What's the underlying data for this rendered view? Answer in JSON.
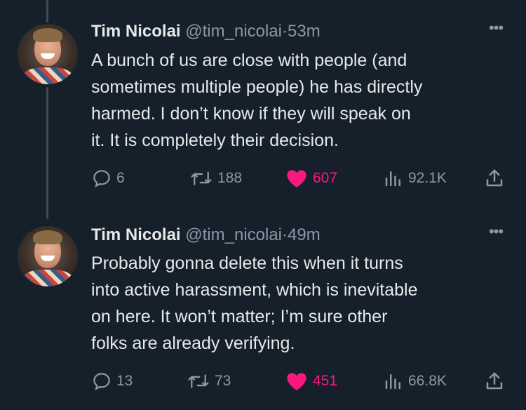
{
  "tweets": [
    {
      "name": "Tim Nicolai",
      "handle": "@tim_nicolai",
      "separator": "·",
      "time": "53m",
      "more": "•••",
      "lines": [
        "A bunch of us are close with people (and",
        "sometimes multiple people) he has directly",
        "harmed. I don’t know if they will speak on",
        "it. It is completely their decision."
      ],
      "replies": "6",
      "retweets": "188",
      "likes": "607",
      "views": "92.1K"
    },
    {
      "name": "Tim Nicolai",
      "handle": "@tim_nicolai",
      "separator": "·",
      "time": "49m",
      "more": "•••",
      "lines": [
        "Probably gonna delete this when it turns",
        "into active harassment, which is inevitable",
        "on here. It won’t matter; I’m sure other",
        "folks are already verifying."
      ],
      "replies": "13",
      "retweets": "73",
      "likes": "451",
      "views": "66.8K"
    }
  ],
  "colors": {
    "background": "#15202b",
    "text": "#e7e9ea",
    "muted": "#8b98a5",
    "like": "#f91880"
  }
}
